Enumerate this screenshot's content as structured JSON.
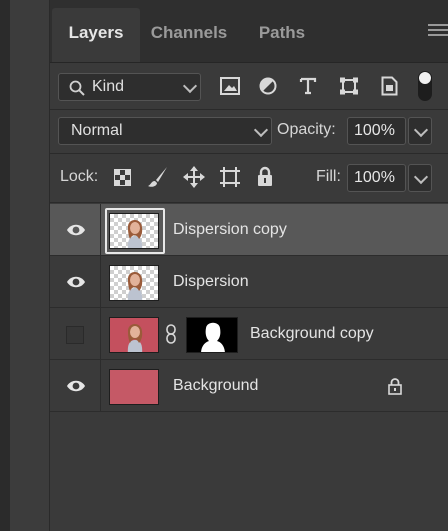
{
  "tabs": [
    {
      "label": "Layers",
      "active": true
    },
    {
      "label": "Channels",
      "active": false
    },
    {
      "label": "Paths",
      "active": false
    }
  ],
  "filter": {
    "kind_label": "Kind",
    "icons": [
      "image-filter-icon",
      "adjustment-filter-icon",
      "type-filter-icon",
      "shape-filter-icon",
      "smart-object-filter-icon",
      "filter-toggle"
    ]
  },
  "blend": {
    "mode": "Normal",
    "opacity_label": "Opacity:",
    "opacity_value": "100%"
  },
  "lock": {
    "label": "Lock:",
    "fill_label": "Fill:",
    "fill_value": "100%"
  },
  "layers": [
    {
      "name": "Dispersion copy",
      "visible": true,
      "selected": true
    },
    {
      "name": "Dispersion",
      "visible": true,
      "selected": false
    },
    {
      "name": "Background copy",
      "visible": false,
      "selected": false,
      "has_mask": true
    },
    {
      "name": "Background",
      "visible": true,
      "selected": false,
      "locked": true
    }
  ],
  "colors": {
    "panel_bg": "#3a3a3a",
    "selected_row": "#585858",
    "field_bg": "#2e2e2e",
    "text": "#e4e4e4",
    "layer_fill": "#c55966"
  }
}
